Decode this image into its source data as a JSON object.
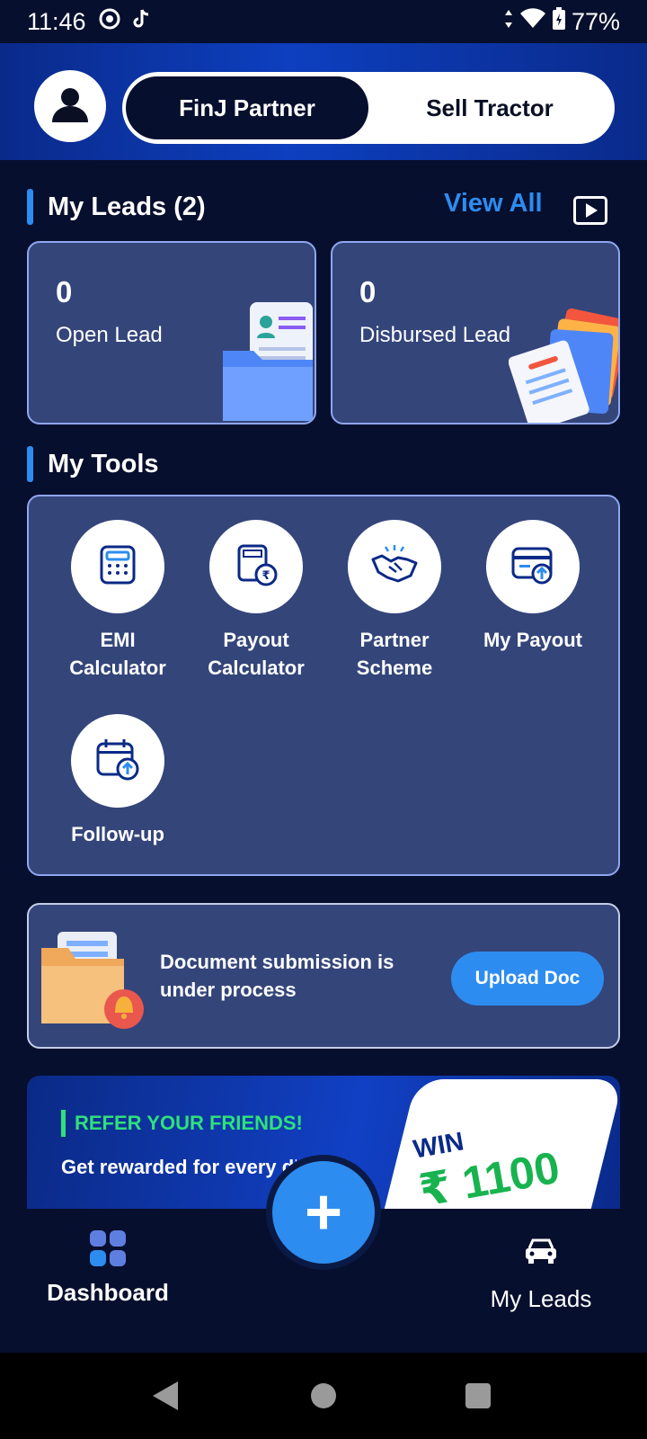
{
  "status_bar": {
    "time": "11:46",
    "battery": "77%",
    "icons": [
      "chrome-icon",
      "tiktok-icon",
      "data-arrows-icon",
      "wifi-icon",
      "battery-charging-icon"
    ]
  },
  "header": {
    "avatar_icon": "user-icon",
    "tabs": [
      {
        "label": "FinJ Partner",
        "active": true
      },
      {
        "label": "Sell Tractor",
        "active": false
      }
    ]
  },
  "leads": {
    "title": "My Leads (2)",
    "view_all": "View All",
    "cards": [
      {
        "count": "0",
        "label": "Open Lead",
        "icon": "open-lead-folder-icon"
      },
      {
        "count": "0",
        "label": "Disbursed Lead",
        "icon": "disbursed-lead-files-icon"
      }
    ]
  },
  "tools": {
    "title": "My Tools",
    "items": [
      {
        "label": "EMI Calculator",
        "icon": "calculator-icon"
      },
      {
        "label": "Payout Calculator",
        "icon": "rupee-calculator-icon"
      },
      {
        "label": "Partner Scheme",
        "icon": "handshake-icon"
      },
      {
        "label": "My Payout",
        "icon": "card-upload-icon"
      },
      {
        "label": "Follow-up",
        "icon": "calendar-upload-icon"
      }
    ]
  },
  "document": {
    "message": "Document submission is under process",
    "button": "Upload Doc"
  },
  "refer": {
    "title": "REFER YOUR FRIENDS!",
    "body": "Get rewarded for every disbursed FinJ lead",
    "win": "WIN",
    "amount": "₹ 1100"
  },
  "bottom_nav": {
    "dashboard": "Dashboard",
    "my_leads": "My Leads"
  },
  "colors": {
    "background": "#070f2e",
    "accent": "#2d8cf0",
    "card": "#34457a",
    "refer_green": "#2fe07a"
  }
}
